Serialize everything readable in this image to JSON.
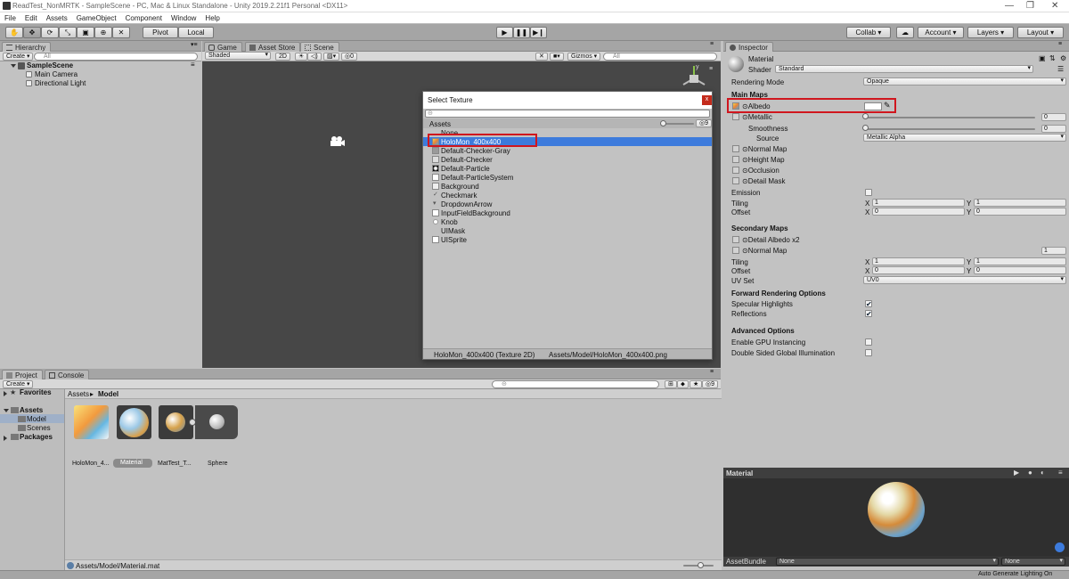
{
  "window": {
    "title": "ReadTest_NonMRTK - SampleScene - PC, Mac & Linux Standalone - Unity 2019.2.21f1 Personal <DX11>"
  },
  "menu": [
    "File",
    "Edit",
    "Assets",
    "GameObject",
    "Component",
    "Window",
    "Help"
  ],
  "toolbar": {
    "pivot": "Pivot",
    "local": "Local",
    "collab": "Collab ▾",
    "account": "Account ▾",
    "layers": "Layers ▾",
    "layout": "Layout ▾"
  },
  "hierarchy": {
    "tab": "Hierarchy",
    "create": "Create ▾",
    "search_placeholder": "All",
    "scene": "SampleScene",
    "items": [
      "Main Camera",
      "Directional Light"
    ]
  },
  "scene_view": {
    "tabs": [
      "Game",
      "Asset Store",
      "Scene"
    ],
    "shading": "Shaded",
    "mode_2d": "2D",
    "gizmos": "Gizmos ▾",
    "search_placeholder": "All",
    "hidden_count": "0"
  },
  "select_texture": {
    "title": "Select Texture",
    "close": "x",
    "tab": "Assets",
    "hidden_count": "9",
    "items": [
      "None",
      "HoloMon_400x400",
      "Default-Checker-Gray",
      "Default-Checker",
      "Default-Particle",
      "Default-ParticleSystem",
      "Background",
      "Checkmark",
      "DropdownArrow",
      "InputFieldBackground",
      "Knob",
      "UIMask",
      "UISprite"
    ],
    "selected_index": 1,
    "footer_name": "HoloMon_400x400 (Texture 2D)",
    "footer_path": "Assets/Model/HoloMon_400x400.png"
  },
  "project": {
    "tabs": [
      "Project",
      "Console"
    ],
    "create": "Create ▾",
    "favorites": "Favorites",
    "assets": "Assets",
    "model": "Model",
    "scenes": "Scenes",
    "packages": "Packages",
    "breadcrumb_root": "Assets",
    "breadcrumb_sep": "▸",
    "breadcrumb_leaf": "Model",
    "hidden_count": "9",
    "items": [
      "HoloMon_4...",
      "Material",
      "MatTest_T...",
      "Sphere"
    ],
    "footer_path": "Assets/Model/Material.mat"
  },
  "inspector": {
    "tab": "Inspector",
    "name": "Material",
    "shader_label": "Shader",
    "shader": "Standard",
    "rendering_mode_label": "Rendering Mode",
    "rendering_mode": "Opaque",
    "main_maps": "Main Maps",
    "albedo": "Albedo",
    "metallic": "Metallic",
    "metallic_value": "0",
    "smoothness": "Smoothness",
    "smoothness_value": "0",
    "source_label": "Source",
    "source": "Metallic Alpha",
    "normal_map": "Normal Map",
    "height_map": "Height Map",
    "occlusion": "Occlusion",
    "detail_mask": "Detail Mask",
    "emission": "Emission",
    "tiling": "Tiling",
    "offset": "Offset",
    "x": "X",
    "y": "Y",
    "tiling_x": "1",
    "tiling_y": "1",
    "offset_x": "0",
    "offset_y": "0",
    "secondary_maps": "Secondary Maps",
    "detail_albedo": "Detail Albedo x2",
    "sec_normal_map": "Normal Map",
    "sec_normal_value": "1",
    "sec_tiling_x": "1",
    "sec_tiling_y": "1",
    "sec_offset_x": "0",
    "sec_offset_y": "0",
    "uv_set_label": "UV Set",
    "uv_set": "UV0",
    "forward_rendering": "Forward Rendering Options",
    "specular_highlights": "Specular Highlights",
    "specular_checked": true,
    "reflections": "Reflections",
    "reflections_checked": true,
    "advanced_options": "Advanced Options",
    "gpu_instancing": "Enable GPU Instancing",
    "double_sided": "Double Sided Global Illumination",
    "preview_title": "Material",
    "asset_bundle": "AssetBundle",
    "bundle_name": "None",
    "bundle_variant": "None"
  },
  "status": {
    "text": "Auto Generate Lighting On"
  },
  "colors": {
    "highlight": "#3d7bdc",
    "annotation": "#d0161e",
    "scene_bg": "#474747"
  }
}
